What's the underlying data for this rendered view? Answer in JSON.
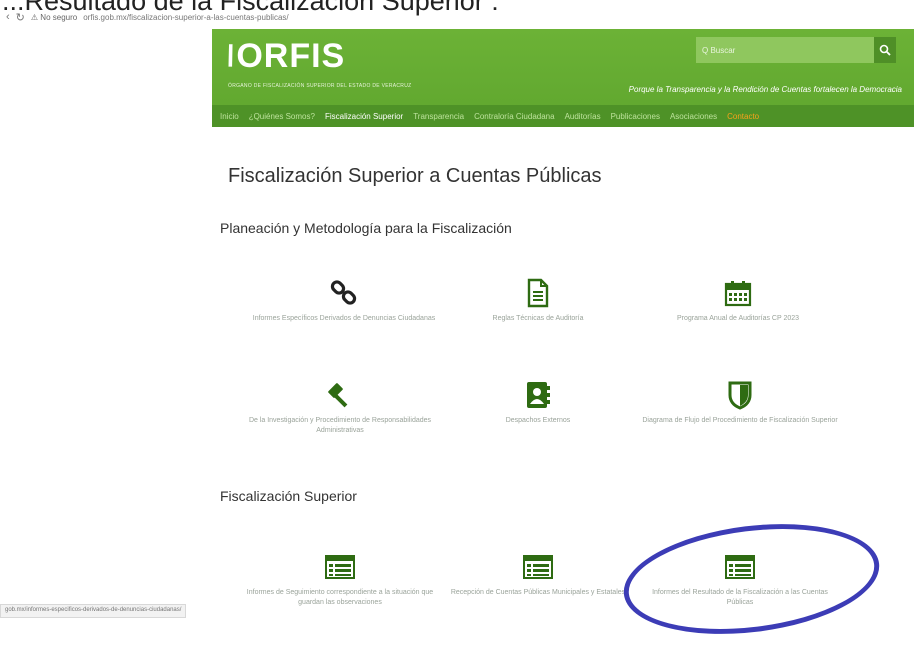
{
  "document_title": "...Resultado de la Fiscalización Superior :",
  "browser": {
    "back_icon": "back-arrow-icon",
    "reload_icon": "reload-icon",
    "security_warning": "No seguro",
    "url": "orfis.gob.mx/fiscalizacion-superior-a-las-cuentas-publicas/"
  },
  "site": {
    "logo_text": "ORFIS",
    "logo_subtitle": "ÓRGANO DE FISCALIZACIÓN SUPERIOR DEL ESTADO DE VERACRUZ",
    "search_placeholder": "Q Buscar",
    "slogan": "Porque la Transparencia y la Rendición de Cuentas fortalecen la Democracia",
    "menu": [
      {
        "label": "Inicio",
        "active": false
      },
      {
        "label": "¿Quiénes Somos?",
        "active": false
      },
      {
        "label": "Fiscalización Superior",
        "active": true
      },
      {
        "label": "Transparencia",
        "active": false
      },
      {
        "label": "Contraloría Ciudadana",
        "active": false
      },
      {
        "label": "Auditorías",
        "active": false
      },
      {
        "label": "Publicaciones",
        "active": false
      },
      {
        "label": "Asociaciones",
        "active": false
      },
      {
        "label": "Contacto",
        "active": false,
        "highlight": true
      }
    ]
  },
  "page": {
    "title": "Fiscalización Superior a Cuentas Públicas",
    "section1": {
      "heading": "Planeación y Metodología para la Fiscalización",
      "items": [
        {
          "icon": "link-icon",
          "label": "Informes Específicos Derivados de Denuncias Ciudadanas"
        },
        {
          "icon": "document-icon",
          "label": "Reglas Técnicas de Auditoría"
        },
        {
          "icon": "calendar-icon",
          "label": "Programa Anual de Auditorías CP 2023"
        },
        {
          "icon": "gavel-icon",
          "label": "De la Investigación y Procedimiento de Responsabilidades Administrativas"
        },
        {
          "icon": "contact-book-icon",
          "label": "Despachos Externos"
        },
        {
          "icon": "shield-icon",
          "label": "Diagrama de Flujo del Procedimiento de Fiscalización Superior"
        }
      ]
    },
    "section2": {
      "heading": "Fiscalización Superior",
      "items": [
        {
          "icon": "list-icon",
          "label": "Informes de Seguimiento correspondiente a la situación que guardan las observaciones"
        },
        {
          "icon": "list-icon",
          "label": "Recepción de Cuentas Públicas Municipales y Estatales"
        },
        {
          "icon": "list-icon",
          "label": "Informes del Resultado de la Fiscalización a las Cuentas Públicas"
        }
      ]
    }
  },
  "status_bar_url": "gob.mx/informes-especificos-derivados-de-denuncias-ciudadanas/",
  "colors": {
    "brand_green": "#5fa62e",
    "menu_green": "#4e9227",
    "icon_green": "#5a9d33",
    "highlight_orange": "#f7a21b",
    "annotation_circle": "#3c3cb6"
  }
}
